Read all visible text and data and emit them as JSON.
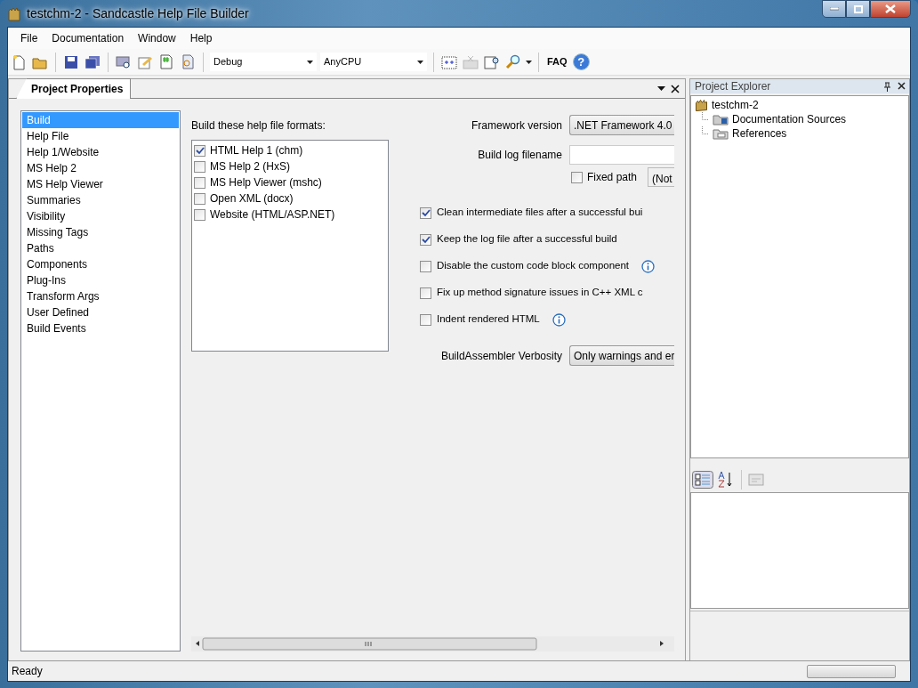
{
  "window": {
    "title": "testchm-2 - Sandcastle Help File Builder"
  },
  "menu": [
    "File",
    "Documentation",
    "Window",
    "Help"
  ],
  "toolbar": {
    "configuration": "Debug",
    "platform": "AnyCPU",
    "faq": "FAQ",
    "help": "?"
  },
  "document_tabs": [
    {
      "label": "Project Properties",
      "selected": true
    }
  ],
  "categories": [
    {
      "label": "Build",
      "selected": true
    },
    {
      "label": "Help File",
      "selected": false
    },
    {
      "label": "Help 1/Website",
      "selected": false
    },
    {
      "label": "MS Help 2",
      "selected": false
    },
    {
      "label": "MS Help Viewer",
      "selected": false
    },
    {
      "label": "Summaries",
      "selected": false
    },
    {
      "label": "Visibility",
      "selected": false
    },
    {
      "label": "Missing Tags",
      "selected": false
    },
    {
      "label": "Paths",
      "selected": false
    },
    {
      "label": "Components",
      "selected": false
    },
    {
      "label": "Plug-Ins",
      "selected": false
    },
    {
      "label": "Transform Args",
      "selected": false
    },
    {
      "label": "User Defined",
      "selected": false
    },
    {
      "label": "Build Events",
      "selected": false
    }
  ],
  "formats": {
    "label": "Build these help file formats:",
    "items": [
      {
        "label": "HTML Help 1 (chm)",
        "checked": true
      },
      {
        "label": "MS Help 2 (HxS)",
        "checked": false
      },
      {
        "label": "MS Help Viewer (mshc)",
        "checked": false
      },
      {
        "label": "Open XML (docx)",
        "checked": false
      },
      {
        "label": "Website (HTML/ASP.NET)",
        "checked": false
      }
    ]
  },
  "framework_version": {
    "label": "Framework version",
    "value": ".NET Framework 4.0"
  },
  "build_log": {
    "label": "Build log filename",
    "fixed_path": {
      "label": "Fixed path",
      "checked": false
    },
    "path_display": "(Not"
  },
  "options": [
    {
      "label": "Clean intermediate files after a successful bui",
      "checked": true,
      "info": false
    },
    {
      "label": "Keep the log file after a successful build",
      "checked": true,
      "info": false
    },
    {
      "label": "Disable the custom code block component",
      "checked": false,
      "info": true
    },
    {
      "label": "Fix up method signature issues in C++ XML c",
      "checked": false,
      "info": false
    },
    {
      "label": "Indent rendered HTML",
      "checked": false,
      "info": true
    }
  ],
  "verbosity": {
    "label": "BuildAssembler Verbosity",
    "value": "Only warnings and er"
  },
  "project_explorer": {
    "title": "Project Explorer",
    "tree": [
      {
        "label": "testchm-2",
        "kind": "project",
        "children": [
          {
            "label": "Documentation Sources",
            "kind": "sources"
          },
          {
            "label": "References",
            "kind": "references"
          }
        ]
      }
    ]
  },
  "status_bar": {
    "text": "Ready",
    "progress": {
      "level": 0
    }
  }
}
